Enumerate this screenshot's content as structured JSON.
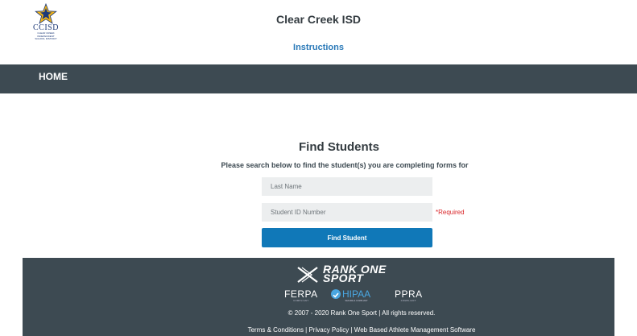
{
  "header": {
    "logo": {
      "name": "CCISD",
      "subtitle_lines": [
        "CLEAR CREEK",
        "INDEPENDENT",
        "SCHOOL DISTRICT"
      ]
    },
    "title": "Clear Creek ISD",
    "instructions_link": "Instructions"
  },
  "nav": {
    "home": "HOME"
  },
  "search": {
    "title": "Find Students",
    "description": "Please search below to find the student(s) you are completing forms for",
    "last_name_placeholder": "Last Name",
    "last_name_value": "",
    "student_id_placeholder": "Student ID Number",
    "student_id_value": "",
    "required_note": "*Required",
    "button_label": "Find Student"
  },
  "footer": {
    "brand_line1": "RANK ONE",
    "brand_line2": "SPORT",
    "compliance": {
      "ferpa": "FERPA",
      "ferpa_sub": "COMPLIANT",
      "hipaa": "HIPAA",
      "hipaa_sub": "SECURE & COMPLIANT",
      "ppra": "PPRA",
      "ppra_sub": "COMPLIANT"
    },
    "copyright": "© 2007 - 2020 Rank One Sport | All rights reserved.",
    "links": [
      "Terms & Conditions",
      "Privacy Policy",
      "Web Based Athlete Management Software"
    ],
    "separator": " | "
  },
  "colors": {
    "navbar": "#3d4a52",
    "accent_link": "#2a79b8",
    "button": "#1078b8",
    "required": "#d9262a",
    "logo_star": "#f2b316",
    "logo_blue": "#1d3a78"
  }
}
